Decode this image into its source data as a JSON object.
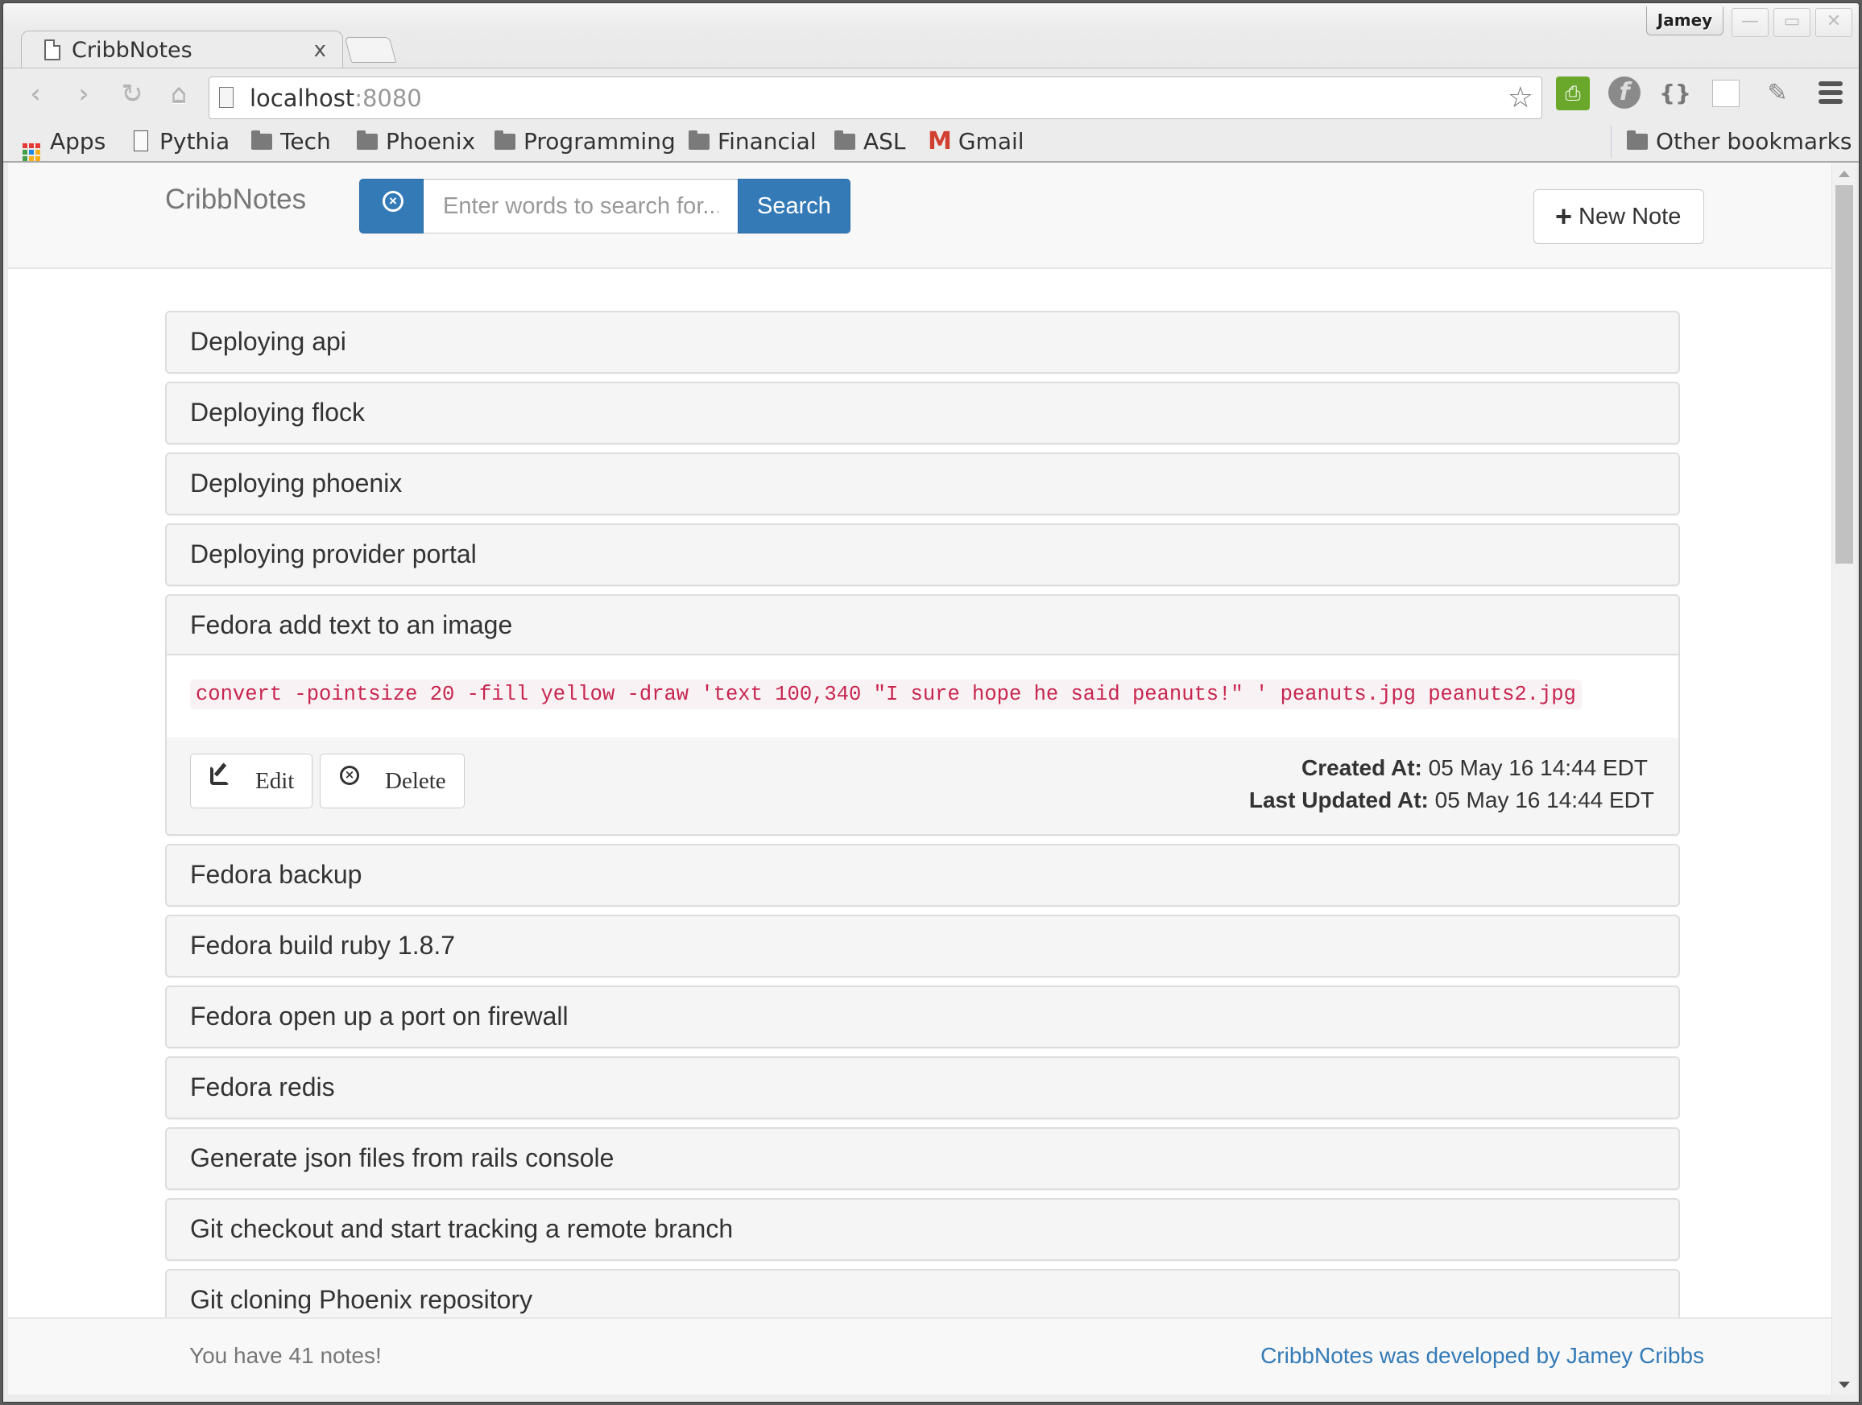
{
  "browser": {
    "tab": {
      "title": "CribbNotes",
      "close_glyph": "x"
    },
    "profile_name": "Jamey",
    "window_buttons": [
      "minimize",
      "maximize",
      "close"
    ],
    "url": {
      "host": "localhost",
      "port": ":8080"
    },
    "bookmarks": [
      {
        "label": "Apps",
        "icon": "apps-grid-icon"
      },
      {
        "label": "Pythia",
        "icon": "page-icon"
      },
      {
        "label": "Tech",
        "icon": "folder-icon"
      },
      {
        "label": "Phoenix",
        "icon": "folder-icon"
      },
      {
        "label": "Programming",
        "icon": "folder-icon"
      },
      {
        "label": "Financial",
        "icon": "folder-icon"
      },
      {
        "label": "ASL",
        "icon": "folder-icon"
      },
      {
        "label": "Gmail",
        "icon": "gmail-icon"
      }
    ],
    "other_bookmarks": "Other bookmarks",
    "extensions": [
      "print-friendly-icon",
      "fedora-icon",
      "json-formatter-icon",
      "blank-window-icon",
      "spreadsheet-edit-icon"
    ]
  },
  "app": {
    "brand": "CribbNotes",
    "search": {
      "placeholder": "Enter words to search for...",
      "value": "",
      "button_label": "Search"
    },
    "new_note_label": "New Note",
    "notes": [
      {
        "title": "Deploying api"
      },
      {
        "title": "Deploying flock"
      },
      {
        "title": "Deploying phoenix"
      },
      {
        "title": "Deploying provider portal"
      },
      {
        "title": "Fedora add text to an image",
        "expanded": true,
        "body_code": "convert -pointsize 20 -fill yellow -draw 'text 100,340 \"I sure hope he said peanuts!\" ' peanuts.jpg peanuts2.jpg",
        "edit_label": "Edit",
        "delete_label": "Delete",
        "created_label": "Created At:",
        "created_value": "05 May 16 14:44 EDT",
        "updated_label": "Last Updated At:",
        "updated_value": "05 May 16 14:44 EDT"
      },
      {
        "title": "Fedora backup"
      },
      {
        "title": "Fedora build ruby 1.8.7"
      },
      {
        "title": "Fedora open up a port on firewall"
      },
      {
        "title": "Fedora redis"
      },
      {
        "title": "Generate json files from rails console"
      },
      {
        "title": "Git checkout and start tracking a remote branch"
      },
      {
        "title": "Git cloning Phoenix repository"
      }
    ],
    "footer": {
      "note_count_text": "You have 41 notes!",
      "credit_text": "CribbNotes was developed by Jamey Cribbs"
    },
    "colors": {
      "primary": "#337ab7",
      "code_text": "#c7254e",
      "code_bg": "#f9f2f4",
      "panel_bg": "#f5f5f5"
    }
  }
}
